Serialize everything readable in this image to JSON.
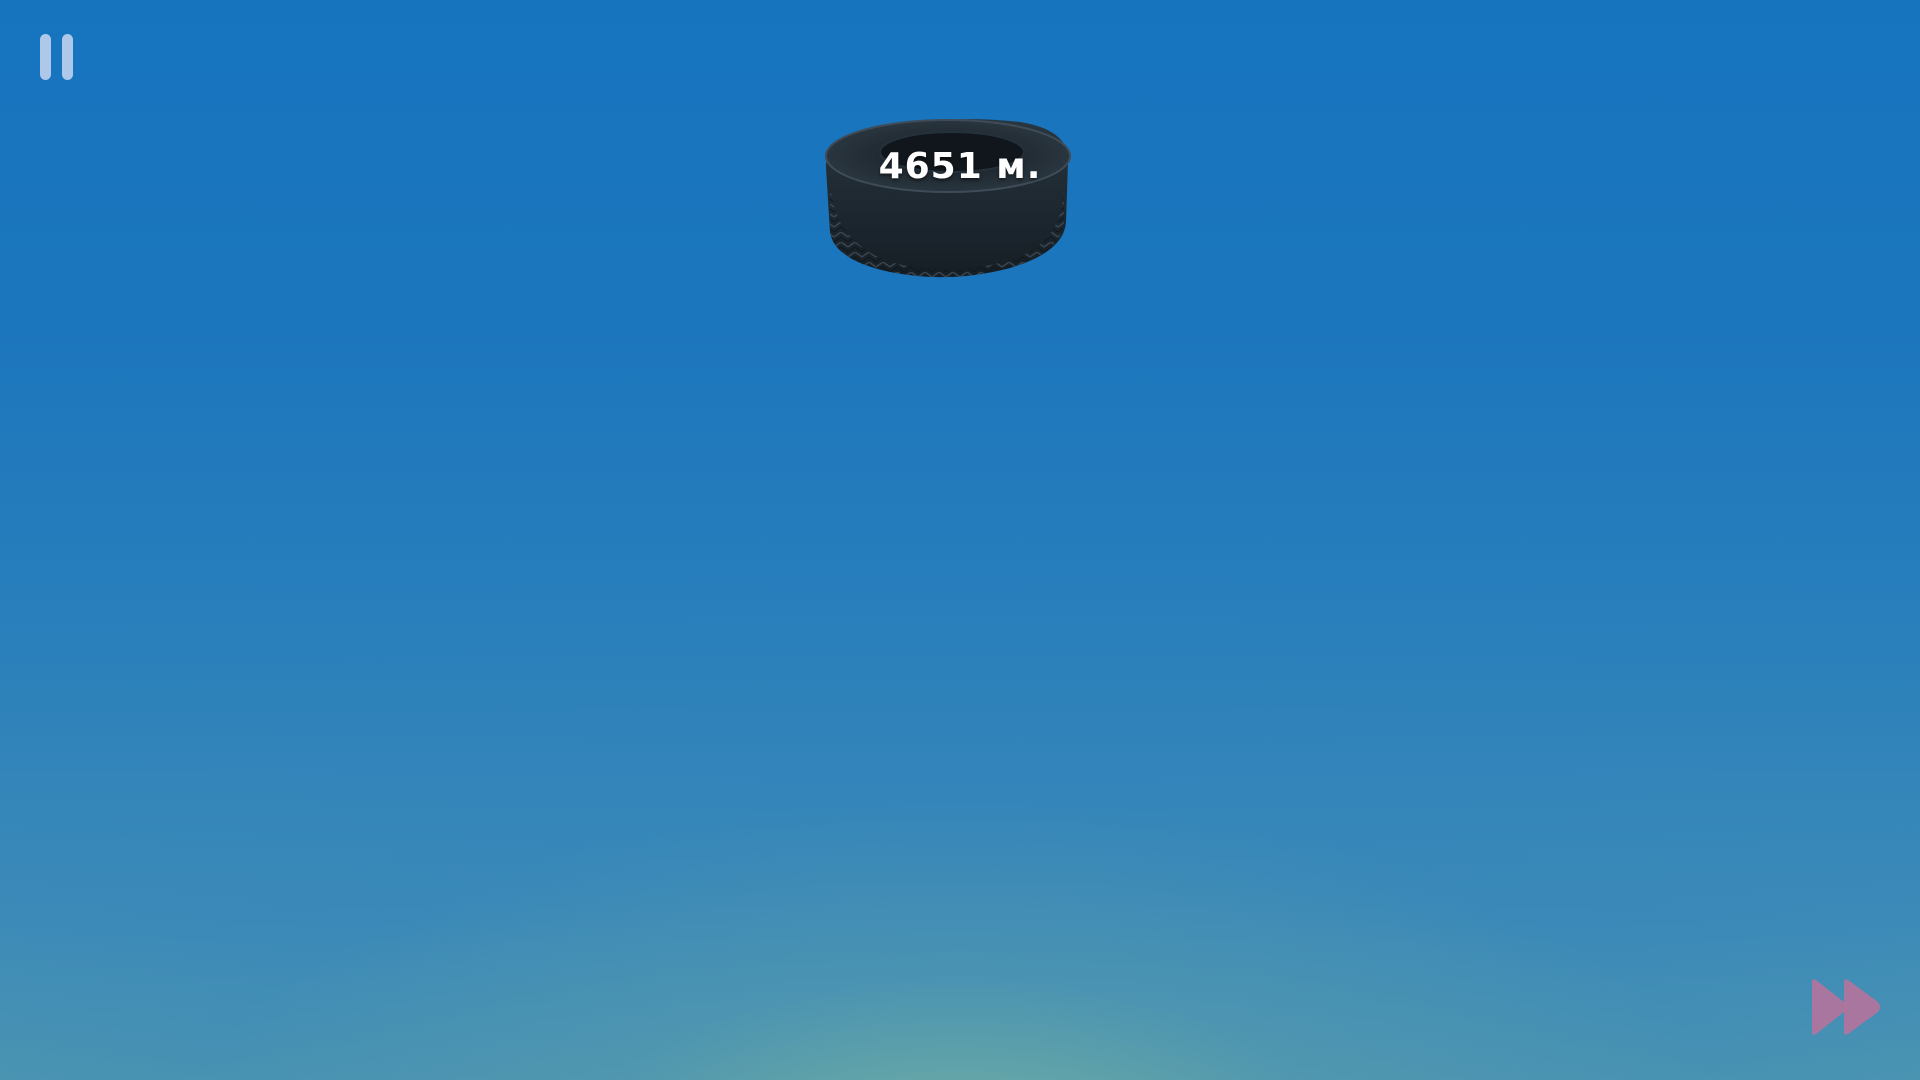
{
  "hud": {
    "distance_text": "4651 м.",
    "pause_icon": "pause-icon",
    "fast_forward_icon": "fast-forward-icon"
  },
  "scene": {
    "object": "tire-icon"
  },
  "colors": {
    "sky_top": "#1674be",
    "sky_bottom": "#4f97b0",
    "pause_icon": "#c8d7f0",
    "fast_forward_icon": "#b5739c",
    "tire": "#1f2a33"
  }
}
